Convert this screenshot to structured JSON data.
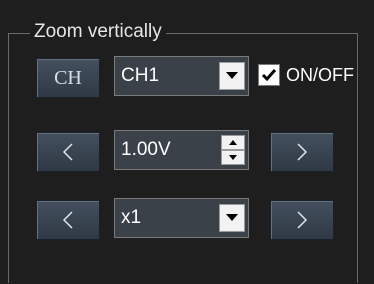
{
  "panel": {
    "title": "Zoom vertically"
  },
  "channel_row": {
    "ch_button_label": "CH",
    "channel_select_value": "CH1",
    "onoff_label": "ON/OFF",
    "onoff_checked": true
  },
  "volts_row": {
    "prev_icon": "chevron-left-icon",
    "value": "1.00V",
    "next_icon": "chevron-right-icon"
  },
  "multiplier_row": {
    "prev_icon": "chevron-left-icon",
    "select_value": "x1",
    "next_icon": "chevron-right-icon"
  },
  "colors": {
    "background": "#1e1e1e",
    "button": "#3a4552",
    "field": "#3a4148",
    "text": "#ffffff"
  }
}
